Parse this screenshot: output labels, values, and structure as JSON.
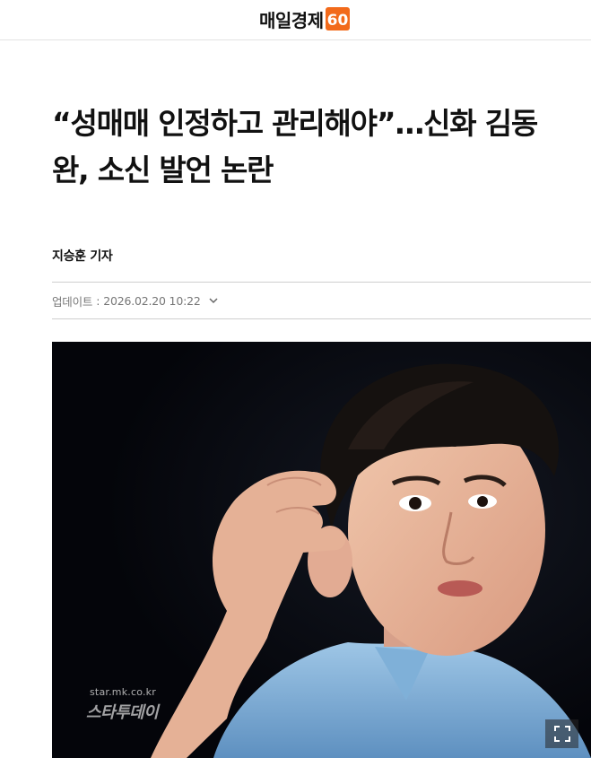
{
  "header": {
    "logo_text": "매일경제",
    "logo_badge_text": "60",
    "brand_color": "#f26a1b"
  },
  "article": {
    "headline": "“성매매 인정하고 관리해야”…신화 김동완, 소신 발언 논란",
    "byline": "지승훈 기자",
    "update_label": "업데이트",
    "update_separator": ":",
    "update_time": "2026.02.20 10:22",
    "update_toggle_icon": "chevron-down-icon"
  },
  "photo": {
    "watermark_site": "star.mk.co.kr",
    "watermark_brand": "스타투데이",
    "expand_icon": "expand-icon"
  }
}
